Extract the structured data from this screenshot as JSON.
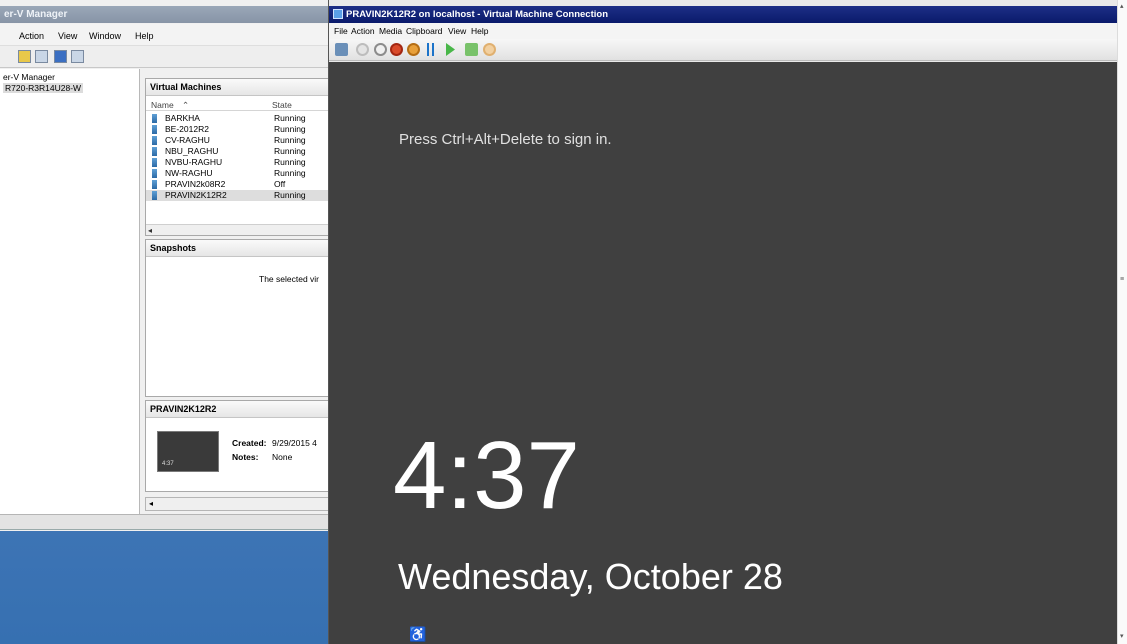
{
  "hyperv": {
    "title": "er-V Manager",
    "menu": [
      "Action",
      "View",
      "Window",
      "Help"
    ],
    "tree": [
      "er-V Manager",
      "R720-R3R14U28-W"
    ],
    "vm_pane": {
      "title": "Virtual Machines",
      "col_name": "Name",
      "sort_glyph": "⌃",
      "col_state": "State",
      "rows": [
        {
          "name": "BARKHA",
          "state": "Running"
        },
        {
          "name": "BE-2012R2",
          "state": "Running"
        },
        {
          "name": "CV-RAGHU",
          "state": "Running"
        },
        {
          "name": "NBU_RAGHU",
          "state": "Running"
        },
        {
          "name": "NVBU-RAGHU",
          "state": "Running"
        },
        {
          "name": "NW-RAGHU",
          "state": "Running"
        },
        {
          "name": "PRAVIN2k08R2",
          "state": "Off"
        },
        {
          "name": "PRAVIN2K12R2",
          "state": "Running"
        }
      ]
    },
    "snapshots": {
      "title": "Snapshots",
      "message": "The selected vir"
    },
    "details": {
      "title": "PRAVIN2K12R2",
      "thumb_time": "4:37",
      "created_label": "Created:",
      "created_value": "9/29/2015 4",
      "notes_label": "Notes:",
      "notes_value": "None"
    },
    "scroll_arrow": "◂"
  },
  "vmc": {
    "title": "PRAVIN2K12R2 on localhost - Virtual Machine Connection",
    "menu": [
      "File",
      "Action",
      "Media",
      "Clipboard",
      "View",
      "Help"
    ],
    "lock": {
      "hint": "Press Ctrl+Alt+Delete to sign in.",
      "time": "4:37",
      "date": "Wednesday, October 28",
      "ease_glyph": "♿"
    }
  },
  "right_strip": {
    "top": "▴",
    "mid": "≡",
    "bottom": "▾"
  }
}
